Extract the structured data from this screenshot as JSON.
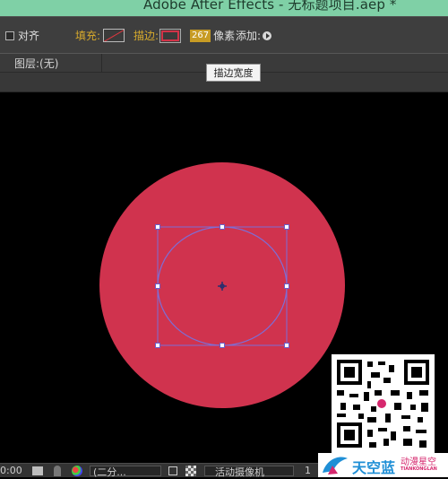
{
  "window": {
    "title": "Adobe After Effects - 无标题项目.aep *"
  },
  "toolbar": {
    "align_label": "对齐",
    "fill_label": "填充:",
    "stroke_label": "描边:",
    "stroke_width_value": "267",
    "stroke_width_unit": "像素",
    "add_label": "添加:"
  },
  "tooltip": {
    "text": "描边宽度"
  },
  "layer_bar": {
    "label": "图层:(无)"
  },
  "composition": {
    "shape_fill_color": "#d0334e",
    "path_color": "#7d6ed6",
    "background_color": "#000000"
  },
  "bottom_bar": {
    "timecode": "0:00",
    "resolution": "(二分...",
    "camera": "活动摄像机",
    "views": "1"
  },
  "watermark": {
    "brand_cn": "天空蓝",
    "brand_sub": "动漫星空",
    "brand_en": "TIANKONGLAN"
  }
}
